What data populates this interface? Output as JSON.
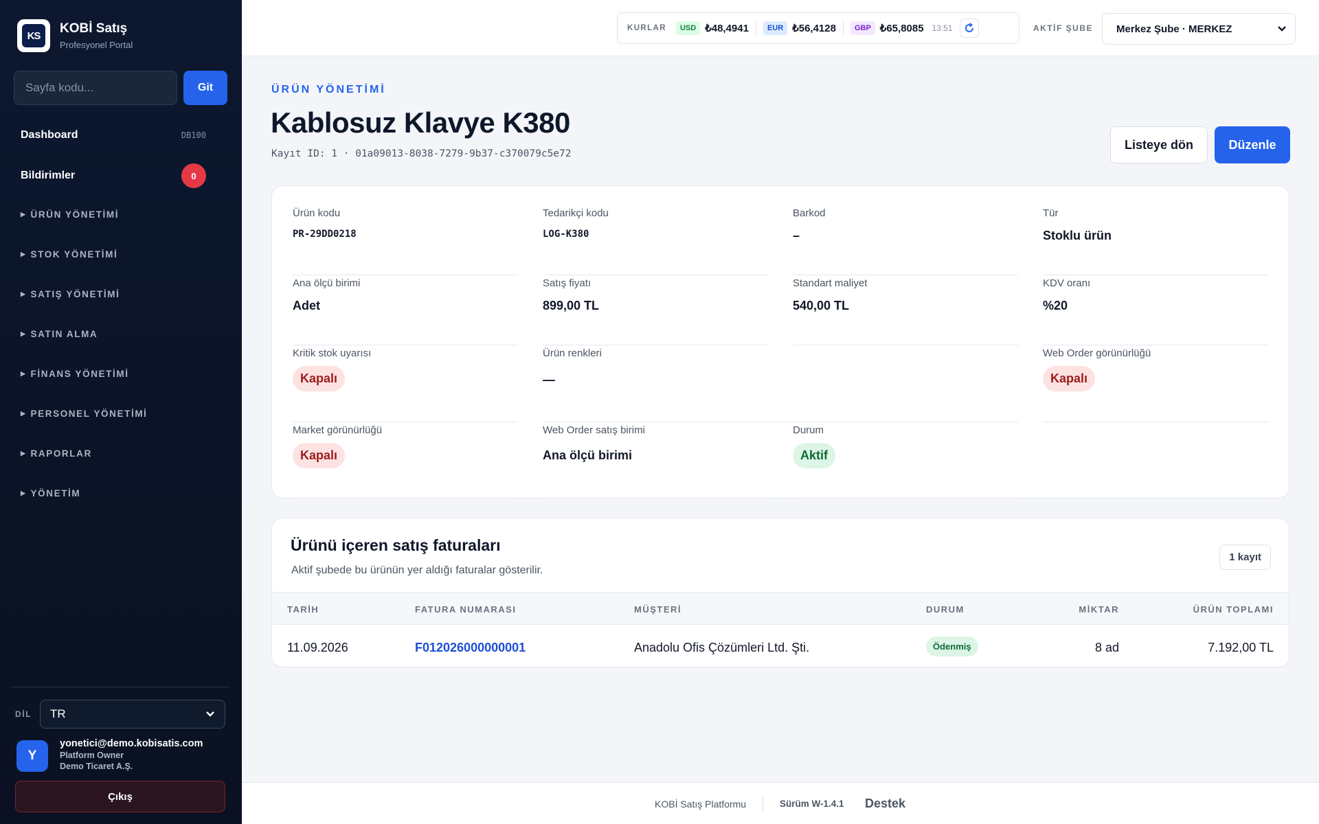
{
  "sidebar": {
    "brand_name": "KOBİ Satış",
    "brand_sub": "Profesyonel Portal",
    "logo_text": "KS",
    "page_code_placeholder": "Sayfa kodu...",
    "go_label": "Git",
    "dashboard": {
      "label": "Dashboard",
      "code": "DB100"
    },
    "notifications": {
      "label": "Bildirimler",
      "count": "0"
    },
    "groups": [
      "ÜRÜN YÖNETİMİ",
      "STOK YÖNETİMİ",
      "SATIŞ YÖNETİMİ",
      "SATIN ALMA",
      "FİNANS YÖNETİMİ",
      "PERSONEL YÖNETİMİ",
      "RAPORLAR",
      "YÖNETİM"
    ],
    "lang_label": "DİL",
    "lang_value": "TR",
    "user": {
      "initial": "Y",
      "email": "yonetici@demo.kobisatis.com",
      "role": "Platform Owner",
      "company": "Demo Ticaret A.Ş."
    },
    "logout_label": "Çıkış"
  },
  "topbar": {
    "rates_label": "KURLAR",
    "rates": [
      {
        "code": "USD",
        "value": "₺48,4941",
        "bg": "#dcfce7",
        "fg": "#15803d"
      },
      {
        "code": "EUR",
        "value": "₺56,4128",
        "bg": "#dbeafe",
        "fg": "#1d4ed8"
      },
      {
        "code": "GBP",
        "value": "₺65,8085",
        "bg": "#f3e8ff",
        "fg": "#7e22ce"
      }
    ],
    "rate_time": "13:51",
    "branch_label": "AKTİF ŞUBE",
    "branch_value": "Merkez Şube · MERKEZ"
  },
  "header": {
    "eyebrow": "ÜRÜN YÖNETİMİ",
    "title": "Kablosuz Klavye K380",
    "record_id": "Kayıt ID: 1 · 01a09013-8038-7279-9b37-c370079c5e72",
    "back_label": "Listeye dön",
    "edit_label": "Düzenle"
  },
  "details": {
    "product_code": {
      "label": "Ürün kodu",
      "value": "PR-29DD0218"
    },
    "supplier_code": {
      "label": "Tedarikçi kodu",
      "value": "LOG-K380"
    },
    "barcode": {
      "label": "Barkod",
      "value": "–"
    },
    "type": {
      "label": "Tür",
      "value": "Stoklu ürün"
    },
    "unit": {
      "label": "Ana ölçü birimi",
      "value": "Adet"
    },
    "sale_price": {
      "label": "Satış fiyatı",
      "value": "899,00 TL"
    },
    "std_cost": {
      "label": "Standart maliyet",
      "value": "540,00 TL"
    },
    "vat": {
      "label": "KDV oranı",
      "value": "%20"
    },
    "critical_stock": {
      "label": "Kritik stok uyarısı",
      "value": "Kapalı"
    },
    "colors": {
      "label": "Ürün renkleri",
      "value": "—"
    },
    "web_order_visibility": {
      "label": "Web Order görünürlüğü",
      "value": "Kapalı"
    },
    "market_visibility": {
      "label": "Market görünürlüğü",
      "value": "Kapalı"
    },
    "web_order_unit": {
      "label": "Web Order satış birimi",
      "value": "Ana ölçü birimi"
    },
    "status": {
      "label": "Durum",
      "value": "Aktif"
    }
  },
  "invoices": {
    "title": "Ürünü içeren satış faturaları",
    "subtitle": "Aktif şubede bu ürünün yer aldığı faturalar gösterilir.",
    "count_label": "1 kayıt",
    "columns": [
      "TARİH",
      "FATURA NUMARASI",
      "MÜŞTERİ",
      "DURUM",
      "MİKTAR",
      "ÜRÜN TOPLAMI"
    ],
    "rows": [
      {
        "date": "11.09.2026",
        "number": "F012026000000001",
        "customer": "Anadolu Ofis Çözümleri Ltd. Şti.",
        "status": "Ödenmiş",
        "qty": "8 ad",
        "total": "7.192,00 TL"
      }
    ]
  },
  "footer": {
    "platform": "KOBİ Satış Platformu",
    "version": "Sürüm W-1.4.1",
    "support": "Destek"
  }
}
